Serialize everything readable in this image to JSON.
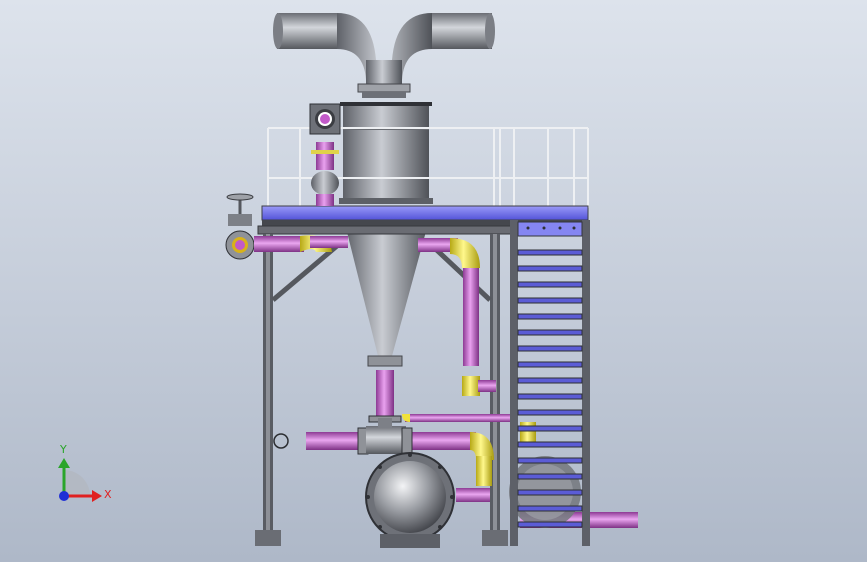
{
  "viewport": {
    "background_top": "#dde3ec",
    "background_bottom": "#aeb8c8"
  },
  "triad": {
    "y_label": "Y",
    "x_label": "X",
    "y_color": "#2aa52a",
    "x_color": "#e02020",
    "z_color": "#1f2fd6"
  },
  "colors": {
    "steel": "#8a8d94",
    "frame": "#5d6068",
    "magenta_pipe": "#c25ac9",
    "yellow_pipe": "#f0e23a",
    "deck": "#6f6ff0",
    "rail": "#e8eaee"
  }
}
